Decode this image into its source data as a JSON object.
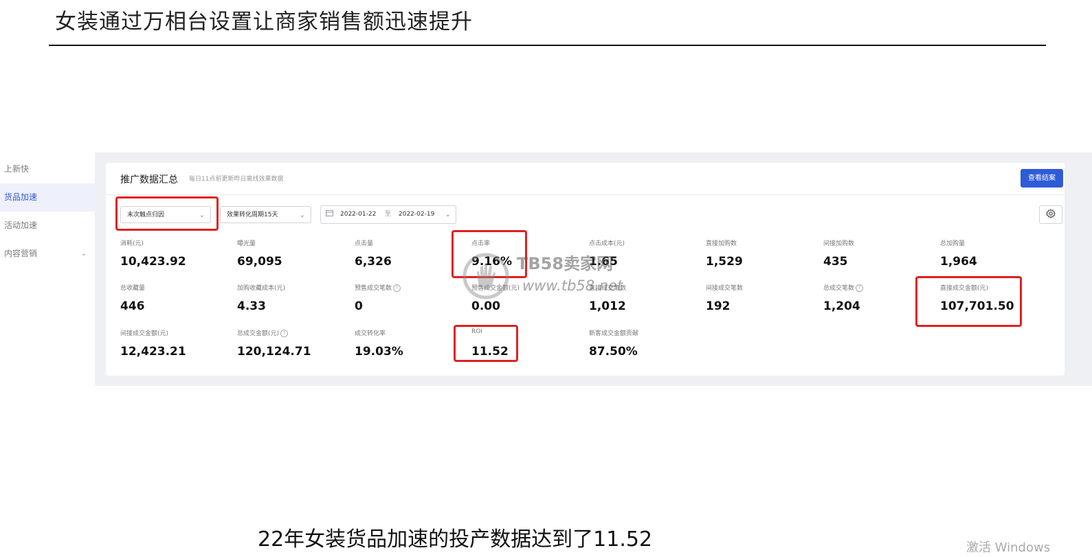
{
  "slide": {
    "title": "女装通过万相台设置让商家销售额迅速提升",
    "caption": "22年女装货品加速的投产数据达到了11.52"
  },
  "sidebar": {
    "items": [
      {
        "label": "上新快",
        "active": false
      },
      {
        "label": "货品加速",
        "active": true
      },
      {
        "label": "活动加速",
        "active": false
      },
      {
        "label": "内容营销",
        "active": false,
        "expandable": true
      }
    ]
  },
  "panel": {
    "title": "推广数据汇总",
    "subtitle": "每日11点前更新昨日离线效果数据",
    "view_report_label": "查看结案"
  },
  "filters": {
    "attribution": "末次触点归因",
    "conversion_period": "效果转化周期15天",
    "date_start": "2022-01-22",
    "date_separator": "至",
    "date_end": "2022-02-19"
  },
  "metrics": {
    "row1": [
      {
        "label": "消耗(元)",
        "value": "10,423.92"
      },
      {
        "label": "曝光量",
        "value": "69,095"
      },
      {
        "label": "点击量",
        "value": "6,326"
      },
      {
        "label": "点击率",
        "value": "9.16%"
      },
      {
        "label": "点击成本(元)",
        "value": "1.65"
      },
      {
        "label": "直接加购数",
        "value": "1,529"
      },
      {
        "label": "间接加购数",
        "value": "435"
      },
      {
        "label": "总加购量",
        "value": "1,964"
      }
    ],
    "row2": [
      {
        "label": "总收藏量",
        "value": "446"
      },
      {
        "label": "加购收藏成本(元)",
        "value": "4.33"
      },
      {
        "label": "预售成交笔数",
        "value": "0"
      },
      {
        "label": "预售成交金额(元)",
        "value": "0.00"
      },
      {
        "label": "直接成交笔数",
        "value": "1,012"
      },
      {
        "label": "间接成交笔数",
        "value": "192"
      },
      {
        "label": "总成交笔数",
        "value": "1,204"
      },
      {
        "label": "直接成交金额(元)",
        "value": "107,701.50"
      }
    ],
    "row3": [
      {
        "label": "间接成交金额(元)",
        "value": "12,423.21"
      },
      {
        "label": "总成交金额(元)",
        "value": "120,124.71"
      },
      {
        "label": "成交转化率",
        "value": "19.03%"
      },
      {
        "label": "ROI",
        "value": "11.52"
      },
      {
        "label": "新客成交金额贡献",
        "value": "87.50%"
      }
    ]
  },
  "watermark": {
    "brand": "TB58卖家网",
    "url": "www.tb58.net"
  },
  "os_overlay": {
    "text": "激活 Windows"
  },
  "colors": {
    "accent": "#2e5bd8",
    "highlight": "#e02020"
  }
}
